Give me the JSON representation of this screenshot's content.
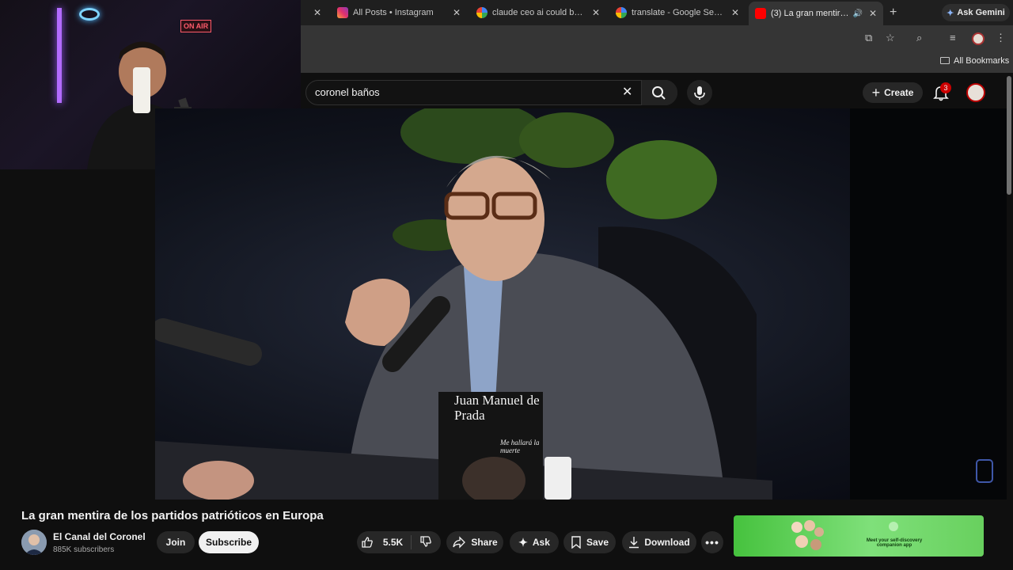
{
  "browser": {
    "tabs": [
      {
        "title": "",
        "favicon": "blank",
        "close": "✕"
      },
      {
        "title": "All Posts • Instagram",
        "favicon": "instagram-icon",
        "close": "✕"
      },
      {
        "title": "claude ceo ai could be con",
        "favicon": "google-icon",
        "close": "✕"
      },
      {
        "title": "translate - Google Search",
        "favicon": "google-icon",
        "close": "✕"
      },
      {
        "title": "(3) La gran mentira de l",
        "favicon": "youtube-icon",
        "close": "✕",
        "active": true
      }
    ],
    "new_tab": "+",
    "gemini_label": "Ask Gemini",
    "bookmarks_label": "All Bookmarks"
  },
  "webcam": {
    "on_air_sign": "ON AIR"
  },
  "youtube": {
    "search_value": "coronel baños",
    "create_label": "Create",
    "notification_count": "3"
  },
  "video": {
    "title": "La gran mentira de los partidos patrióticos en Europa",
    "channel_name": "El Canal del Coronel",
    "subscribers": "885K subscribers",
    "join_label": "Join",
    "subscribe_label": "Subscribe",
    "like_count": "5.5K",
    "share_label": "Share",
    "ask_label": "Ask",
    "save_label": "Save",
    "download_label": "Download",
    "book_author": "Juan Manuel de Prada",
    "book_title": "Me hallará la muerte"
  },
  "ad": {
    "text": "Meet your self-discovery companion app"
  },
  "colors": {
    "yt_bg": "#0f0f0f",
    "chrome_dark": "#1f1f1f",
    "chrome_mid": "#353535",
    "badge_red": "#cc0000",
    "ad_green": "#5ccd50"
  }
}
